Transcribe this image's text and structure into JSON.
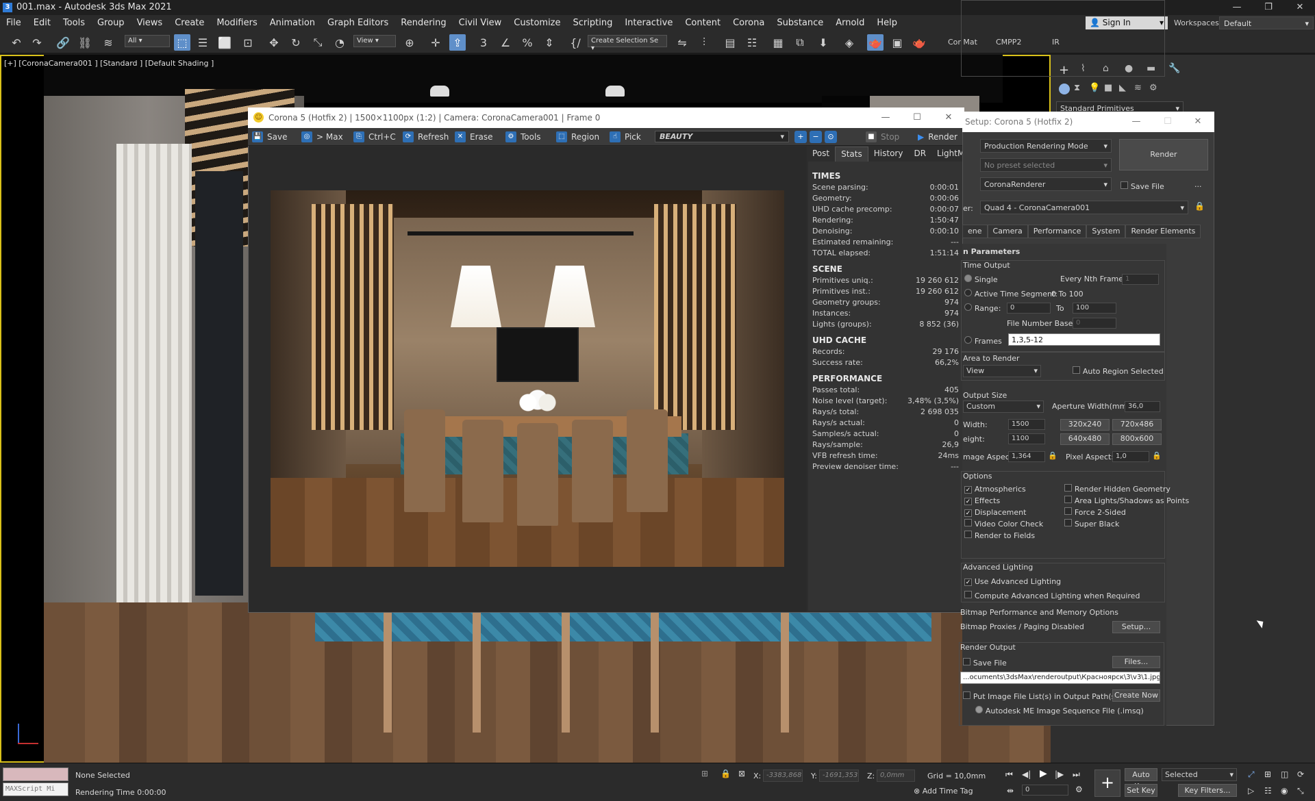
{
  "titlebar": {
    "title": "001.max - Autodesk 3ds Max 2021",
    "icon": "3",
    "minimize": "—",
    "restore": "❐",
    "close": "✕"
  },
  "menu": [
    "File",
    "Edit",
    "Tools",
    "Group",
    "Views",
    "Create",
    "Modifiers",
    "Animation",
    "Graph Editors",
    "Rendering",
    "Civil View",
    "Customize",
    "Scripting",
    "Interactive",
    "Content",
    "Corona",
    "Substance",
    "Arnold",
    "Help"
  ],
  "account": {
    "signin": "Sign In",
    "workspaces_label": "Workspaces:",
    "workspace": "Default"
  },
  "toolbar": {
    "filter": "All",
    "refcoord": "View",
    "selset": "Create Selection Se",
    "labels": [
      "Cor Mat",
      "CMPP2",
      "IR"
    ]
  },
  "viewport": {
    "label": "[+] [CoronaCamera001 ] [Standard ] [Default Shading ]"
  },
  "vfb": {
    "title": "Corona 5 (Hotfix 2) | 1500×1100px (1:2) | Camera: CoronaCamera001 | Frame 0",
    "buttons": {
      "save": "Save",
      "max": "> Max",
      "copy": "Ctrl+C",
      "refresh": "Refresh",
      "erase": "Erase",
      "tools": "Tools",
      "region": "Region",
      "pick": "Pick",
      "stop": "Stop",
      "render": "Render"
    },
    "element": "BEAUTY",
    "tabs": [
      "Post",
      "Stats",
      "History",
      "DR",
      "LightMix"
    ],
    "stats": [
      {
        "title": "TIMES",
        "rows": [
          [
            "Scene parsing:",
            "0:00:01"
          ],
          [
            "Geometry:",
            "0:00:06"
          ],
          [
            "UHD cache precomp:",
            "0:00:07"
          ],
          [
            "Rendering:",
            "1:50:47"
          ],
          [
            "Denoising:",
            "0:00:10"
          ],
          [
            "Estimated remaining:",
            "---"
          ],
          [
            "TOTAL elapsed:",
            "1:51:14"
          ]
        ]
      },
      {
        "title": "SCENE",
        "rows": [
          [
            "Primitives uniq.:",
            "19 260 612"
          ],
          [
            "Primitives inst.:",
            "19 260 612"
          ],
          [
            "Geometry groups:",
            "974"
          ],
          [
            "Instances:",
            "974"
          ],
          [
            "Lights (groups):",
            "8 852 (36)"
          ]
        ]
      },
      {
        "title": "UHD CACHE",
        "rows": [
          [
            "Records:",
            "29 176"
          ],
          [
            "Success rate:",
            "66,2%"
          ]
        ]
      },
      {
        "title": "PERFORMANCE",
        "rows": [
          [
            "Passes total:",
            "405"
          ],
          [
            "Noise level (target):",
            "3,48% (3,5%)"
          ],
          [
            "Rays/s total:",
            "2 698 035"
          ],
          [
            "Rays/s actual:",
            "0"
          ],
          [
            "Samples/s actual:",
            "0"
          ],
          [
            "Rays/sample:",
            "26,9"
          ],
          [
            "VFB refresh time:",
            "24ms"
          ],
          [
            "Preview denoiser time:",
            "---"
          ]
        ]
      }
    ]
  },
  "setup": {
    "title": "Setup: Corona 5 (Hotfix 2)",
    "target": "Production Rendering Mode",
    "preset": "No preset selected",
    "renderer": "CoronaRenderer",
    "render_btn": "Render",
    "save_file": "Save File",
    "more": "...",
    "view_label": "er:",
    "view": "Quad 4 - CoronaCamera001",
    "tabs": [
      "ene",
      "Camera",
      "Performance",
      "System",
      "Render Elements"
    ],
    "rollout": "n Parameters",
    "time_output": "Time Output",
    "single": "Single",
    "every_nth": "Every Nth Frame:",
    "every_nth_val": "1",
    "active_seg": "Active Time Segment:",
    "active_seg_val": "0 To 100",
    "range": "Range:",
    "range_from": "0",
    "range_to_label": "To",
    "range_to": "100",
    "file_num_base": "File Number Base:",
    "file_num_base_val": "0",
    "frames": "Frames",
    "frames_val": "1,3,5-12",
    "area_to_render": "Area to Render",
    "area": "View",
    "auto_region": "Auto Region Selected",
    "output_size": "Output Size",
    "size_preset": "Custom",
    "aperture_label": "Aperture Width(mm):",
    "aperture": "36,0",
    "width_label": "Width:",
    "width": "1500",
    "height_label": "eight:",
    "height": "1100",
    "presets": [
      "320x240",
      "720x486",
      "640x480",
      "800x600"
    ],
    "image_aspect_label": "mage Aspect:",
    "image_aspect": "1,364",
    "pixel_aspect_label": "Pixel Aspect:",
    "pixel_aspect": "1,0",
    "options": "Options",
    "opts_left": [
      [
        "Atmospherics",
        true
      ],
      [
        "Effects",
        true
      ],
      [
        "Displacement",
        true
      ],
      [
        "Video Color Check",
        false
      ],
      [
        "Render to Fields",
        false
      ]
    ],
    "opts_right": [
      [
        "Render Hidden Geometry",
        false
      ],
      [
        "Area Lights/Shadows as Points",
        false
      ],
      [
        "Force 2-Sided",
        false
      ],
      [
        "Super Black",
        false
      ]
    ],
    "adv_lighting": "Advanced Lighting",
    "use_adv": "Use Advanced Lighting",
    "compute_adv": "Compute Advanced Lighting when Required",
    "bitmap_perf": "Bitmap Performance and Memory Options",
    "bitmap_proxies": "Bitmap Proxies / Paging Disabled",
    "setup_btn": "Setup...",
    "render_output": "Render Output",
    "save_file2": "Save File",
    "files_btn": "Files...",
    "out_path": "...ocuments\\3dsMax\\renderoutput\\Красноярск\\3\\v3\\1.jpg",
    "put_image": "Put Image File List(s) in Output Path(s)",
    "create_now": "Create Now",
    "imsq": "Autodesk ME Image Sequence File (.imsq)"
  },
  "cmdpanel": {
    "category": "Standard Primitives"
  },
  "status": {
    "maxscript": "MAXScript Mi",
    "selection": "None Selected",
    "render_time": "Rendering Time  0:00:00",
    "x_label": "X:",
    "x": "-3383,868",
    "y_label": "Y:",
    "y": "-1691,353",
    "z_label": "Z:",
    "z": "0,0mm",
    "grid": "Grid = 10,0mm",
    "add_time_tag": "Add Time Tag",
    "auto_key": "Auto Key",
    "set_key": "Set Key",
    "selected": "Selected",
    "key_filters": "Key Filters...",
    "frame": "0"
  }
}
